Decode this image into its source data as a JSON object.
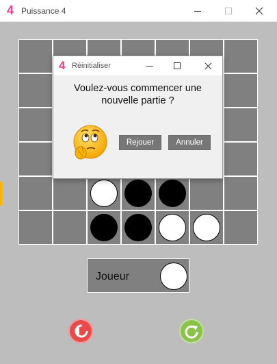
{
  "window": {
    "logo": "4",
    "title": "Puissance 4"
  },
  "board": {
    "cols": 7,
    "rows": 6,
    "discs": [
      {
        "row": 4,
        "col": 2,
        "color": "white"
      },
      {
        "row": 4,
        "col": 3,
        "color": "black"
      },
      {
        "row": 4,
        "col": 4,
        "color": "black"
      },
      {
        "row": 5,
        "col": 2,
        "color": "black"
      },
      {
        "row": 5,
        "col": 3,
        "color": "black"
      },
      {
        "row": 5,
        "col": 4,
        "color": "white"
      },
      {
        "row": 5,
        "col": 5,
        "color": "white"
      }
    ]
  },
  "player": {
    "label": "Joueur",
    "disc_color": "white"
  },
  "dialog": {
    "logo": "4",
    "title": "Réinitialiser",
    "message_line1": "Voulez-vous commencer une",
    "message_line2": "nouvelle partie ?",
    "replay_label": "Rejouer",
    "cancel_label": "Annuler"
  },
  "colors": {
    "accent": "#e83e8c",
    "board": "#808080",
    "back_button": "#e94b4b",
    "reset_button": "#8bc34a"
  }
}
